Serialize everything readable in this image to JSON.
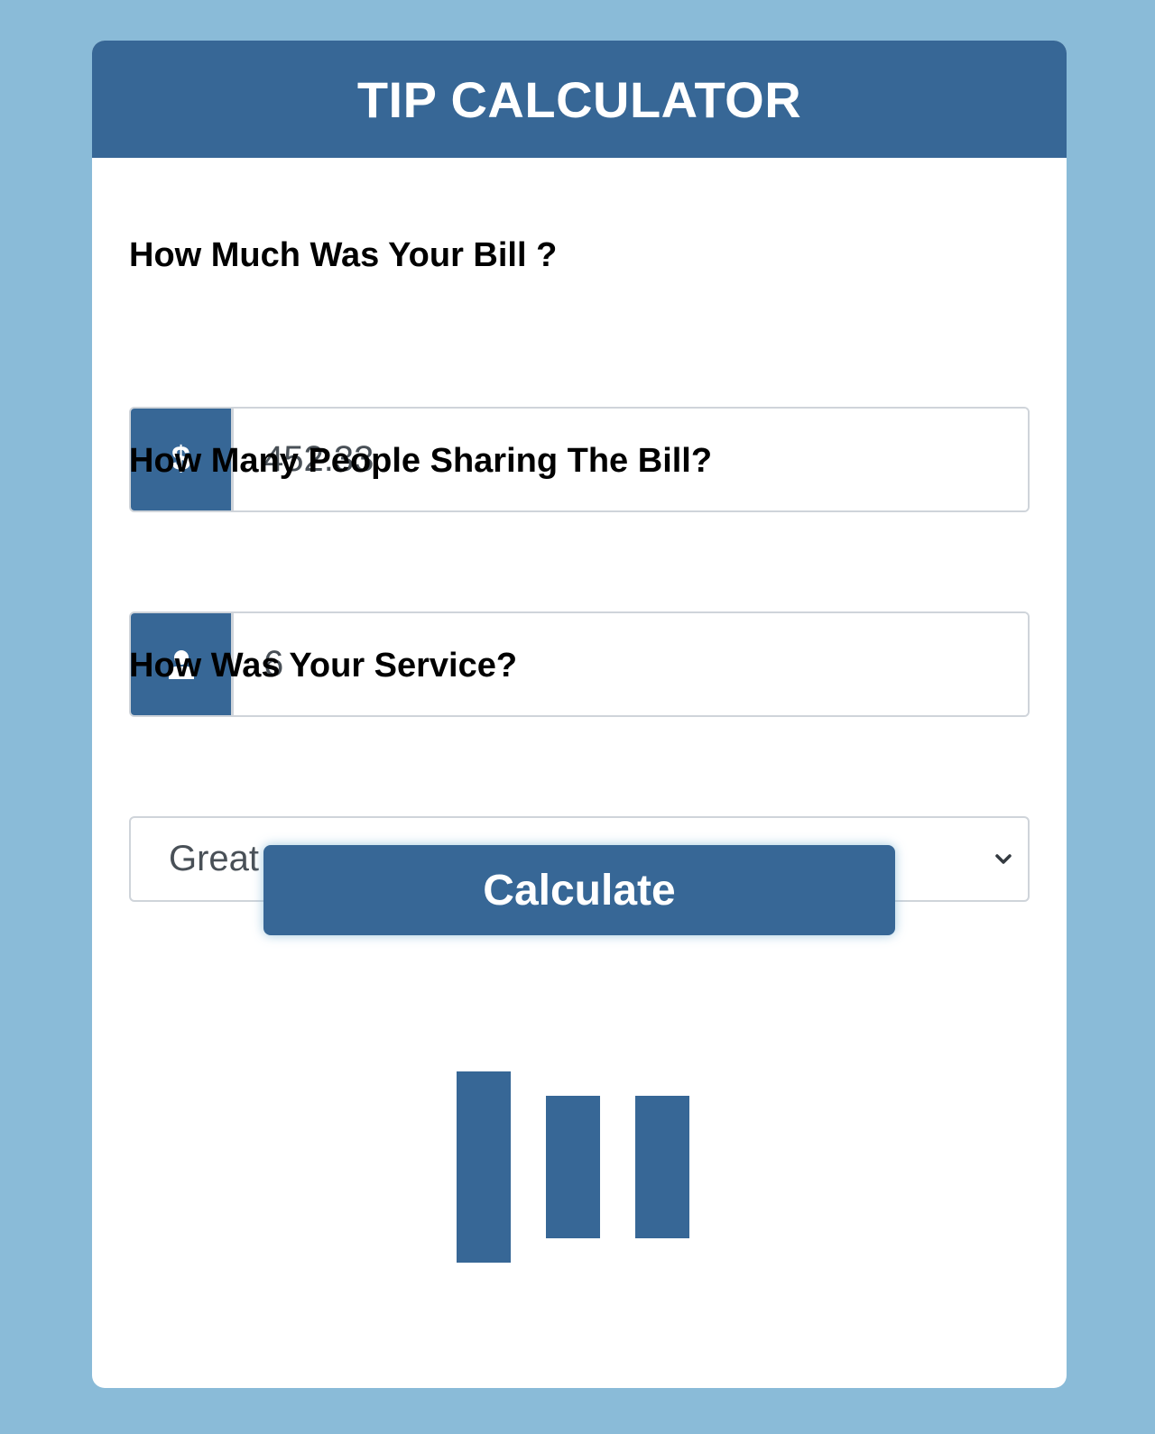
{
  "header": {
    "title": "TIP CALCULATOR"
  },
  "bill": {
    "label": "How Much Was Your Bill ?",
    "currency_symbol": "$",
    "value": "452.33"
  },
  "people": {
    "label": "How Many People Sharing The Bill?",
    "icon": "user-icon",
    "value": "6"
  },
  "service": {
    "label": "How Was Your Service?",
    "selected": "Great - 20%"
  },
  "actions": {
    "calculate_label": "Calculate"
  },
  "loader": {
    "icon": "loading-bars-icon"
  },
  "colors": {
    "background": "#8abbd8",
    "primary": "#376796",
    "card": "#ffffff"
  }
}
